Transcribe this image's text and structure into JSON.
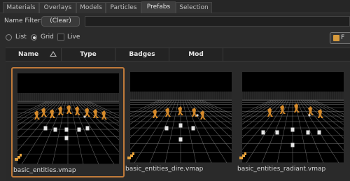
{
  "tabs": [
    {
      "label": "Materials",
      "active": false
    },
    {
      "label": "Overlays",
      "active": false
    },
    {
      "label": "Models",
      "active": false
    },
    {
      "label": "Particles",
      "active": false
    },
    {
      "label": "Prefabs",
      "active": true
    },
    {
      "label": "Selection",
      "active": false
    }
  ],
  "filter": {
    "label": "Name Filter:",
    "clear_label": "(Clear)",
    "value": ""
  },
  "view": {
    "list_label": "List",
    "grid_label": "Grid",
    "live_label": "Live",
    "mode": "grid",
    "live_checked": false,
    "side_button_label": "F"
  },
  "columns": [
    {
      "label": "Name",
      "sorted": "ascending"
    },
    {
      "label": "Type"
    },
    {
      "label": "Badges"
    },
    {
      "label": "Mod"
    }
  ],
  "items": [
    {
      "filename": "basic_entities.vmap",
      "selected": true,
      "icon": "prefab-icon"
    },
    {
      "filename": "basic_entities_dire.vmap",
      "selected": false,
      "icon": "prefab-icon"
    },
    {
      "filename": "basic_entities_radiant.vmap",
      "selected": false,
      "icon": "prefab-icon"
    }
  ],
  "colors": {
    "selection_border": "#c07a3a",
    "prefab_icon": "#e8a33c",
    "figure": "#d68a2a",
    "background": "#2b2b2b"
  }
}
